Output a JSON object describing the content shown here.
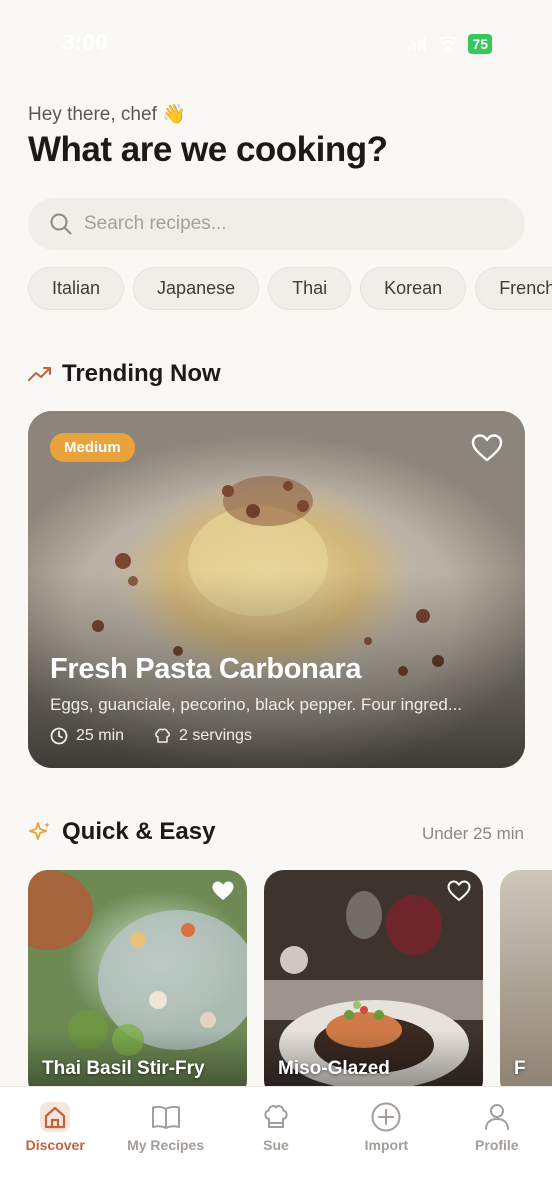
{
  "status_bar": {
    "time": "3:00",
    "battery": "75"
  },
  "header": {
    "greeting": "Hey there, chef 👋",
    "title": "What are we cooking?"
  },
  "search": {
    "placeholder": "Search recipes...",
    "value": ""
  },
  "categories": [
    "Italian",
    "Japanese",
    "Thai",
    "Korean",
    "French"
  ],
  "trending": {
    "section_title": "Trending Now",
    "recipe": {
      "difficulty": "Medium",
      "title": "Fresh Pasta Carbonara",
      "description": "Eggs, guanciale, pecorino, black pepper. Four ingred...",
      "time": "25 min",
      "servings": "2 servings",
      "favorited": false
    }
  },
  "quick": {
    "section_title": "Quick & Easy",
    "meta": "Under 25 min",
    "recipes": [
      {
        "title": "Thai Basil Stir-Fry",
        "favorited": true
      },
      {
        "title": "Miso-Glazed",
        "favorited": false
      },
      {
        "title": "F",
        "favorited": false
      }
    ]
  },
  "tabbar": {
    "items": [
      {
        "label": "Discover",
        "icon": "home-icon",
        "active": true
      },
      {
        "label": "My Recipes",
        "icon": "book-icon",
        "active": false
      },
      {
        "label": "Sue",
        "icon": "chef-hat-icon",
        "active": false
      },
      {
        "label": "Import",
        "icon": "plus-circle-icon",
        "active": false
      },
      {
        "label": "Profile",
        "icon": "person-icon",
        "active": false
      }
    ]
  },
  "colors": {
    "accent": "#c0643a",
    "badge": "#e8a33c",
    "background": "#faf8f5",
    "chip_bg": "#f1ede8",
    "inactive": "#a39e99"
  }
}
